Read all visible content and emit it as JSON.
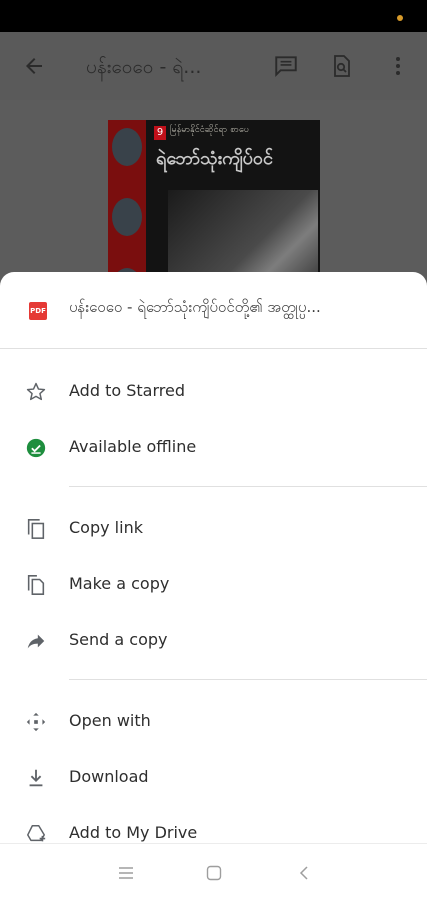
{
  "app_bar": {
    "title": "ပန်းဝေဝေ - ရဲ...",
    "icons": [
      "back-arrow-icon",
      "comment-icon",
      "find-in-page-icon",
      "more-vert-icon"
    ]
  },
  "document": {
    "cover_badge": "9",
    "cover_header": "မြန်မာနိုင်ငံဆိုင်ရာ စာပေ",
    "cover_title": "ရဲဘော်သုံးကျိပ်ဝင်"
  },
  "sheet": {
    "file_name": "ပန်းဝေဝေ - ရဲဘော်သုံးကျိပ်ဝင်တို့၏ အတ္ထုပ္ပ...",
    "file_type_badge": "PDF",
    "items": [
      {
        "label": "Add to Starred",
        "icon": "star-outline-icon"
      },
      {
        "label": "Available offline",
        "icon": "offline-check-icon"
      },
      {
        "label": "Copy link",
        "icon": "copy-link-icon"
      },
      {
        "label": "Make a copy",
        "icon": "file-copy-icon"
      },
      {
        "label": "Send a copy",
        "icon": "send-arrow-icon"
      },
      {
        "label": "Open with",
        "icon": "open-with-icon"
      },
      {
        "label": "Download",
        "icon": "download-icon"
      },
      {
        "label": "Add to My Drive",
        "icon": "add-to-drive-icon"
      }
    ]
  },
  "colors": {
    "offline_green": "#1e8e3e",
    "pdf_red": "#e53935",
    "status_dot": "#d79a2a"
  },
  "nav_bar": {
    "icons": [
      "menu-icon",
      "home-square-icon",
      "back-chevron-icon"
    ]
  }
}
